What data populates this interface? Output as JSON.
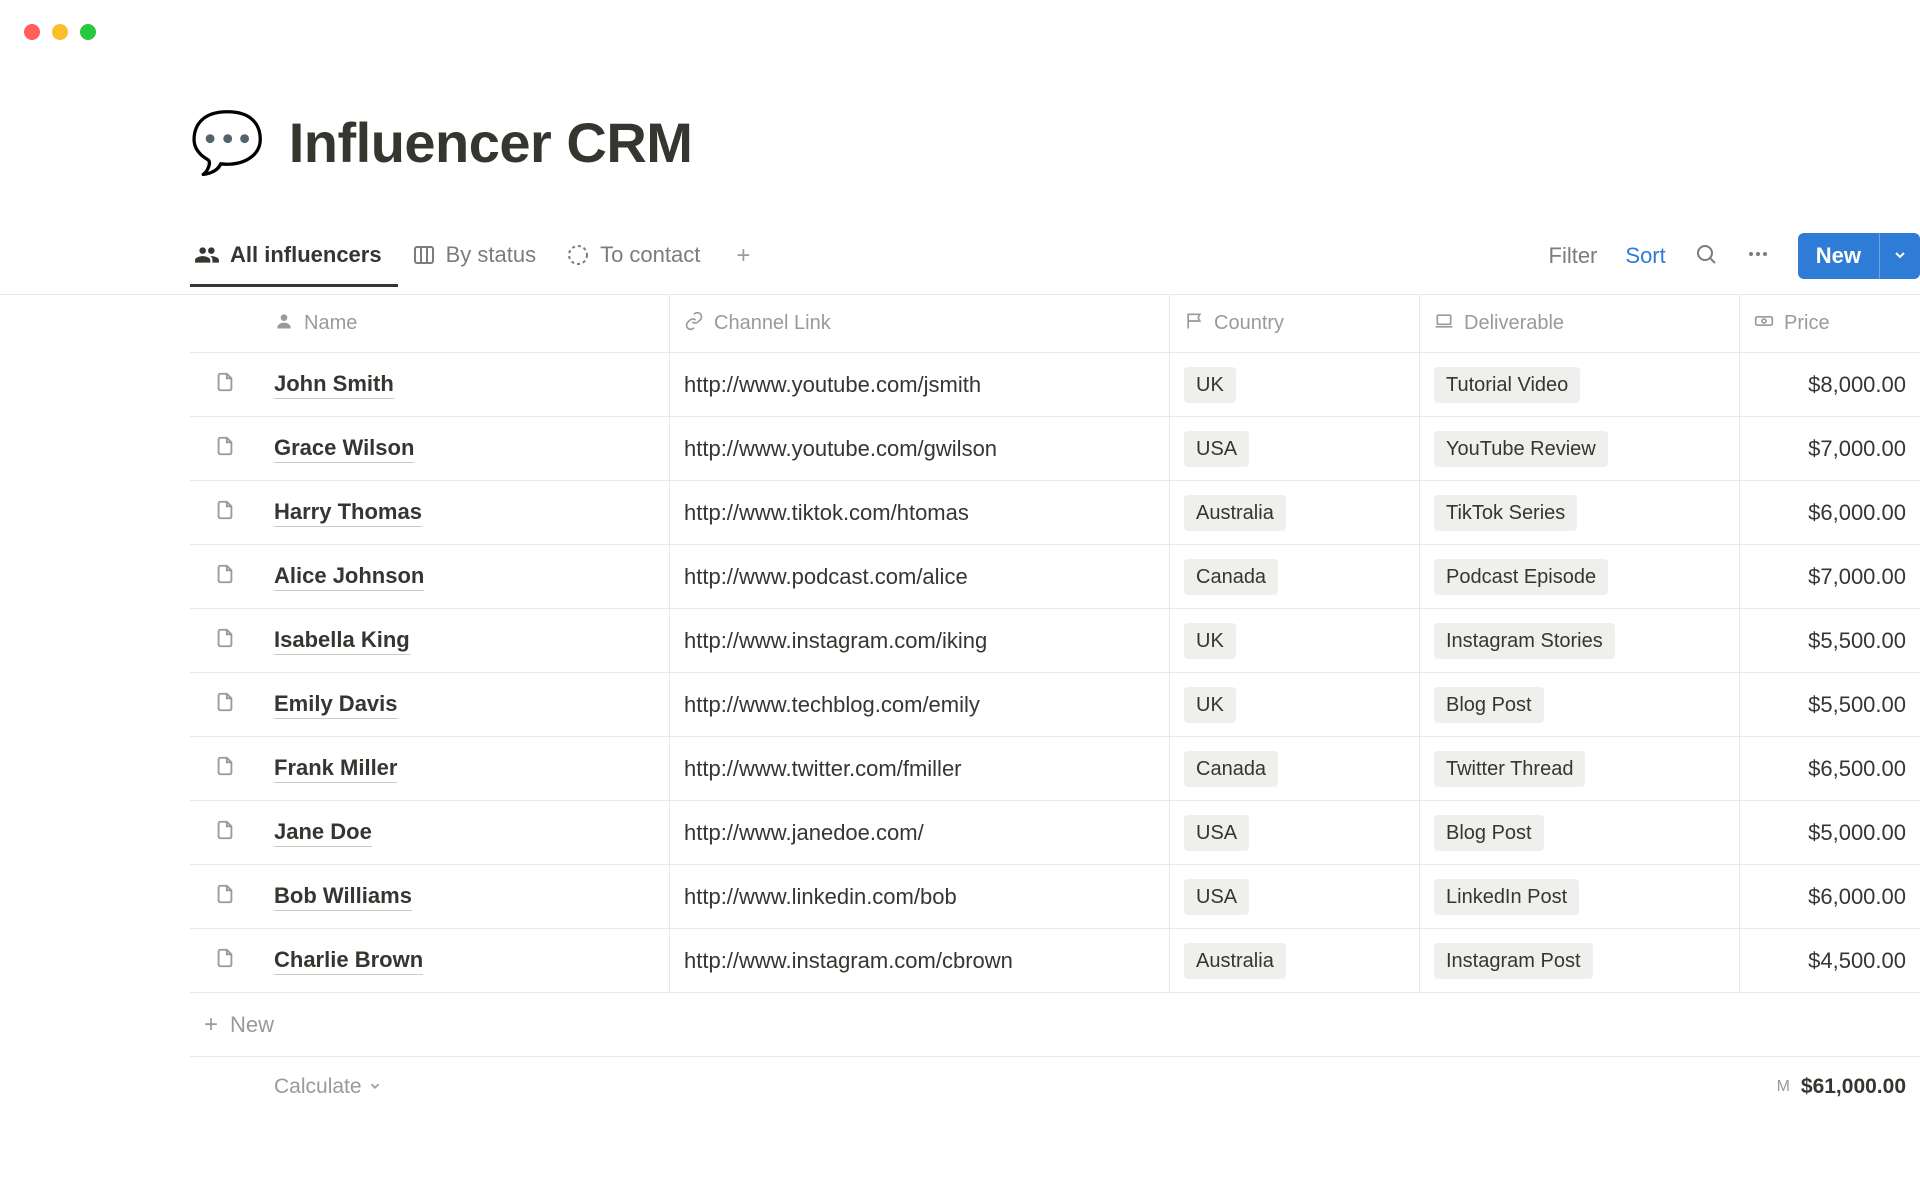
{
  "header": {
    "emoji": "💬",
    "title": "Influencer CRM"
  },
  "tabs": [
    {
      "label": "All influencers",
      "icon": "people",
      "active": true
    },
    {
      "label": "By status",
      "icon": "board",
      "active": false
    },
    {
      "label": "To contact",
      "icon": "dashed-circle",
      "active": false
    }
  ],
  "toolbar": {
    "filter_label": "Filter",
    "sort_label": "Sort",
    "new_label": "New"
  },
  "columns": [
    {
      "key": "name",
      "label": "Name",
      "icon": "person"
    },
    {
      "key": "channel",
      "label": "Channel Link",
      "icon": "link"
    },
    {
      "key": "country",
      "label": "Country",
      "icon": "flag"
    },
    {
      "key": "deliverable",
      "label": "Deliverable",
      "icon": "laptop"
    },
    {
      "key": "price",
      "label": "Price",
      "icon": "money"
    }
  ],
  "rows": [
    {
      "name": "John Smith",
      "channel": "http://www.youtube.com/jsmith",
      "country": "UK",
      "deliverable": "Tutorial Video",
      "price": "$8,000.00"
    },
    {
      "name": "Grace Wilson",
      "channel": "http://www.youtube.com/gwilson",
      "country": "USA",
      "deliverable": "YouTube Review",
      "price": "$7,000.00"
    },
    {
      "name": "Harry Thomas",
      "channel": "http://www.tiktok.com/htomas",
      "country": "Australia",
      "deliverable": "TikTok Series",
      "price": "$6,000.00"
    },
    {
      "name": "Alice Johnson",
      "channel": "http://www.podcast.com/alice",
      "country": "Canada",
      "deliverable": "Podcast Episode",
      "price": "$7,000.00"
    },
    {
      "name": "Isabella King",
      "channel": "http://www.instagram.com/iking",
      "country": "UK",
      "deliverable": "Instagram Stories",
      "price": "$5,500.00"
    },
    {
      "name": "Emily Davis",
      "channel": "http://www.techblog.com/emily",
      "country": "UK",
      "deliverable": "Blog Post",
      "price": "$5,500.00"
    },
    {
      "name": "Frank Miller",
      "channel": "http://www.twitter.com/fmiller",
      "country": "Canada",
      "deliverable": "Twitter Thread",
      "price": "$6,500.00"
    },
    {
      "name": "Jane Doe",
      "channel": "http://www.janedoe.com/",
      "country": "USA",
      "deliverable": "Blog Post",
      "price": "$5,000.00"
    },
    {
      "name": "Bob Williams",
      "channel": "http://www.linkedin.com/bob",
      "country": "USA",
      "deliverable": "LinkedIn Post",
      "price": "$6,000.00"
    },
    {
      "name": "Charlie Brown",
      "channel": "http://www.instagram.com/cbrown",
      "country": "Australia",
      "deliverable": "Instagram Post",
      "price": "$4,500.00"
    }
  ],
  "footer": {
    "new_row_label": "New",
    "calculate_label": "Calculate",
    "sum_prefix": "M",
    "sum_value": "$61,000.00"
  }
}
